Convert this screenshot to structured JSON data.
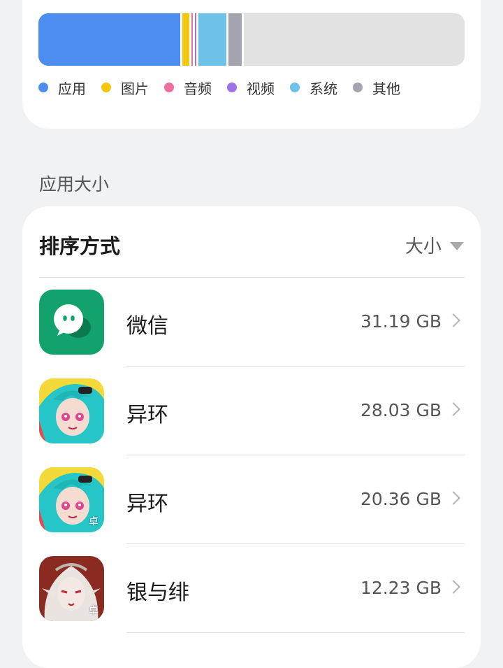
{
  "storage": {
    "segments": [
      {
        "name": "应用",
        "color": "#4d8df0",
        "fraction": 0.333
      },
      {
        "name": "图片",
        "color": "#f4c60c",
        "fraction": 0.016
      },
      {
        "name": "音频",
        "color": "#ee6ea2",
        "fraction": 0.003
      },
      {
        "name": "视频",
        "color": "#a070e8",
        "fraction": 0.003
      },
      {
        "name": "系统",
        "color": "#6ec1e8",
        "fraction": 0.067
      },
      {
        "name": "其他",
        "color": "#a4a4b0",
        "fraction": 0.03
      }
    ],
    "free_color": "#e2e2e2",
    "legend": [
      {
        "label": "应用",
        "color": "#4d8df0"
      },
      {
        "label": "图片",
        "color": "#f4c60c"
      },
      {
        "label": "音频",
        "color": "#ee6ea2"
      },
      {
        "label": "视频",
        "color": "#a070e8"
      },
      {
        "label": "系统",
        "color": "#6ec1e8"
      },
      {
        "label": "其他",
        "color": "#a4a4b0"
      }
    ]
  },
  "apps_section": {
    "title": "应用大小",
    "sort_label": "排序方式",
    "sort_value": "大小",
    "apps": [
      {
        "name": "微信",
        "size": "31.19 GB",
        "icon": "wechat-icon"
      },
      {
        "name": "异环",
        "size": "28.03 GB",
        "icon": "yihuan-icon"
      },
      {
        "name": "异环",
        "size": "20.36 GB",
        "icon": "yihuan-icon",
        "badge": "卓"
      },
      {
        "name": "银与绯",
        "size": "12.23 GB",
        "icon": "yinyufei-icon",
        "badge": "卓"
      }
    ]
  }
}
